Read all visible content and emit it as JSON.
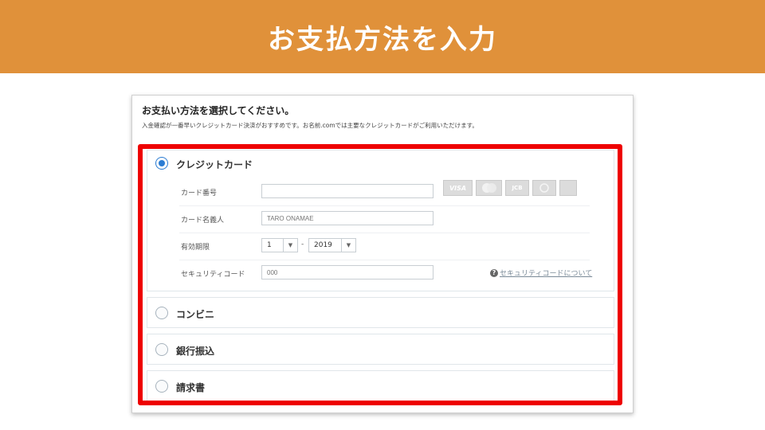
{
  "banner": {
    "title": "お支払方法を入力"
  },
  "panel": {
    "heading": "お支払い方法を選択してください。",
    "description": "入金確認が一番早いクレジットカード決済がおすすめです。お名前.comでは主要なクレジットカードがご利用いただけます。"
  },
  "payment_options": {
    "credit_card": {
      "label": "クレジットカード",
      "selected": true,
      "card_logos": [
        "VISA",
        "MasterCard",
        "JCB",
        "Diners",
        "AMEX"
      ],
      "card_number": {
        "label": "カード番号",
        "value": "",
        "placeholder": ""
      },
      "card_holder": {
        "label": "カード名義人",
        "value": "",
        "placeholder": "TARO ONAMAE"
      },
      "expiry": {
        "label": "有効期限",
        "month": "1",
        "separator": "-",
        "year": "2019"
      },
      "security_code": {
        "label": "セキュリティコード",
        "value": "",
        "placeholder": "000",
        "help_icon": "?",
        "help_link": "セキュリティコードについて"
      }
    },
    "convenience_store": {
      "label": "コンビニ",
      "selected": false
    },
    "bank_transfer": {
      "label": "銀行振込",
      "selected": false
    },
    "invoice": {
      "label": "請求書",
      "selected": false
    }
  },
  "colors": {
    "banner": "#e0913a",
    "highlight": "#ee0000",
    "radio_selected": "#2b7cd3"
  }
}
